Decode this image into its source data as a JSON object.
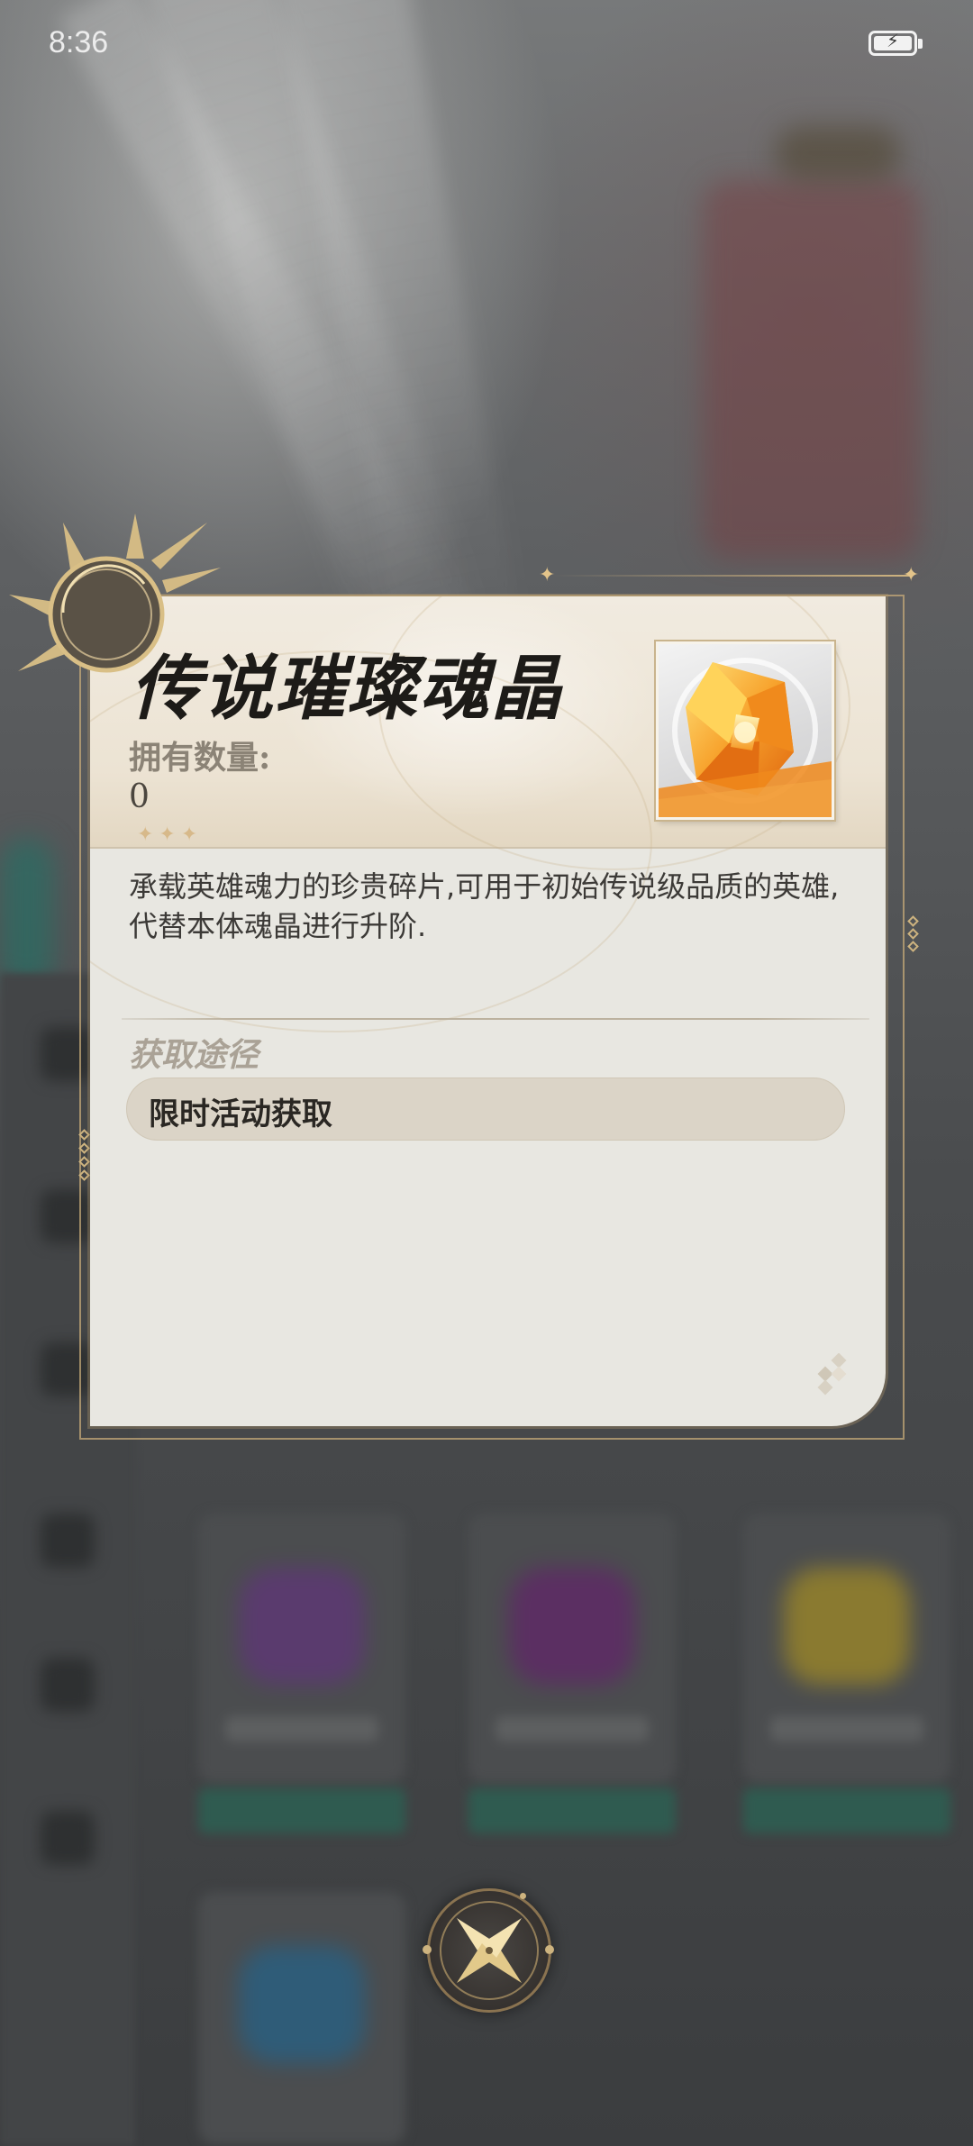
{
  "status_bar": {
    "time": "8:36"
  },
  "dialog": {
    "title": "传说璀璨魂晶",
    "owned_label": "拥有数量:",
    "owned_value": "0",
    "description": "承载英雄魂力的珍贵碎片,可用于初始传说级品质的英雄,代替本体魂晶进行升阶.",
    "source_title": "获取途径",
    "sources": [
      "限时活动获取"
    ],
    "item_icon": "orange-crystal-icon"
  },
  "close_button": {
    "icon": "close-x-icon"
  },
  "colors": {
    "card_bg": "#e8e7e1",
    "header_bg": "#ece3d3",
    "accent_gold": "#cdb37f",
    "title_text": "#1d1b18",
    "pill_bg": "#dbd4c7",
    "crystal_orange": "#f08a1c"
  }
}
